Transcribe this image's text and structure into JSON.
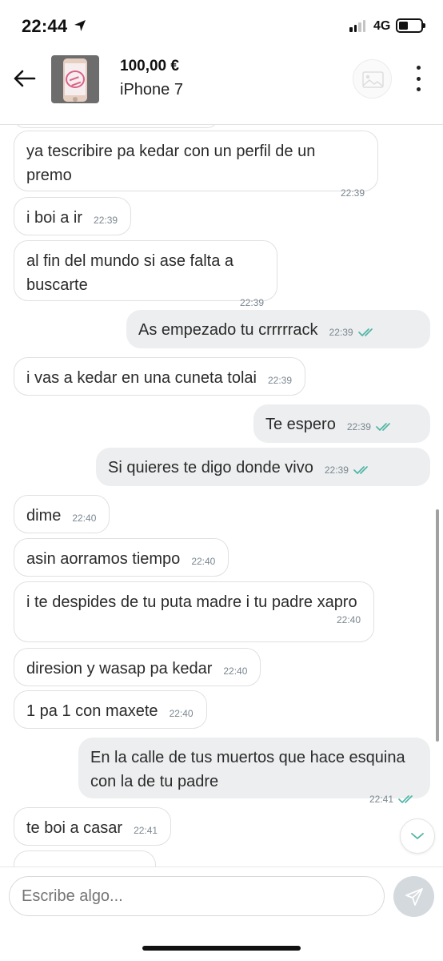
{
  "status_bar": {
    "time": "22:44",
    "network": "4G",
    "icons": [
      "location-arrow-icon",
      "signal-icon",
      "battery-icon"
    ]
  },
  "header": {
    "price": "100,00 €",
    "item_title": "iPhone 7",
    "icons": [
      "back-arrow-icon",
      "avatar-placeholder-icon",
      "more-vertical-icon"
    ]
  },
  "messages": [
    {
      "direction": "in",
      "text": "ya tescribire pa kedar con un perfil de un premo",
      "time": "22:39"
    },
    {
      "direction": "in",
      "text": "i boi a ir",
      "time": "22:39"
    },
    {
      "direction": "in",
      "text": "al fin del mundo si ase falta a buscarte",
      "time": "22:39"
    },
    {
      "direction": "out",
      "text": "As empezado tu crrrrrack",
      "time": "22:39",
      "read": true
    },
    {
      "direction": "in",
      "text": "i vas a kedar en una cuneta tolai",
      "time": "22:39"
    },
    {
      "direction": "out",
      "text": "Te espero",
      "time": "22:39",
      "read": true
    },
    {
      "direction": "out",
      "text": "Si quieres te digo donde vivo",
      "time": "22:39",
      "read": true
    },
    {
      "direction": "in",
      "text": "dime",
      "time": "22:40"
    },
    {
      "direction": "in",
      "text": "asin aorramos tiempo",
      "time": "22:40"
    },
    {
      "direction": "in",
      "text": "i te despides de tu puta madre i tu padre xapro",
      "time": "22:40"
    },
    {
      "direction": "in",
      "text": "diresion y wasap pa kedar",
      "time": "22:40"
    },
    {
      "direction": "in",
      "text": "1 pa 1 con maxete",
      "time": "22:40"
    },
    {
      "direction": "out",
      "text": "En la calle de tus muertos que hace esquina con la de tu padre",
      "time": "22:41",
      "read": true
    },
    {
      "direction": "in",
      "text": "te boi a casar",
      "time": "22:41"
    }
  ],
  "composer": {
    "placeholder": "Escribe algo..."
  },
  "colors": {
    "incoming_border": "#e0e0e0",
    "outgoing_bg": "#eceeef",
    "read_ticks": "#4cb3a4",
    "send_button": "#d3d9dd"
  }
}
